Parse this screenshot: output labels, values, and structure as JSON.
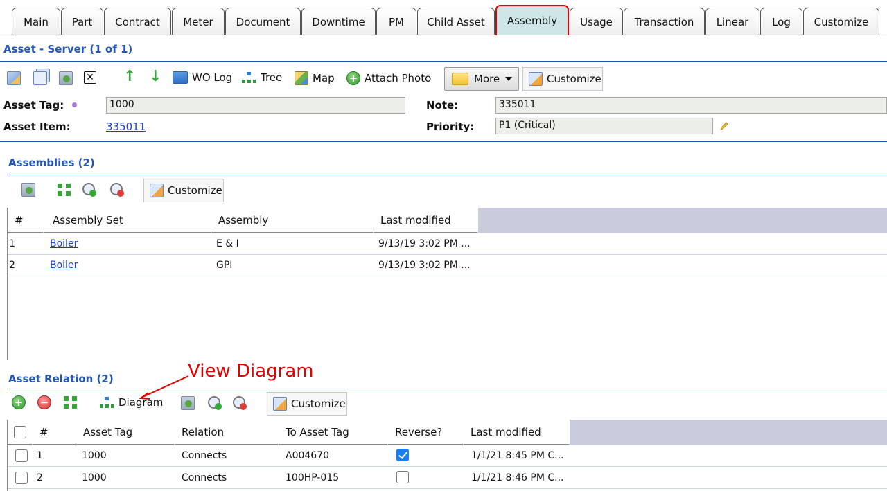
{
  "tabs": [
    {
      "label": "Main"
    },
    {
      "label": "Part"
    },
    {
      "label": "Contract"
    },
    {
      "label": "Meter"
    },
    {
      "label": "Document"
    },
    {
      "label": "Downtime"
    },
    {
      "label": "PM"
    },
    {
      "label": "Child Asset"
    },
    {
      "label": "Assembly",
      "active": true
    },
    {
      "label": "Usage"
    },
    {
      "label": "Transaction"
    },
    {
      "label": "Linear"
    },
    {
      "label": "Log"
    },
    {
      "label": "Customize"
    }
  ],
  "header": {
    "title": "Asset - Server (1 of 1)"
  },
  "toolbar": {
    "wo_log": "WO Log",
    "tree": "Tree",
    "map": "Map",
    "attach_photo": "Attach Photo",
    "more": "More",
    "customize": "Customize"
  },
  "form": {
    "asset_tag_label": "Asset Tag:",
    "asset_tag_value": "1000",
    "asset_item_label": "Asset Item:",
    "asset_item_value": "335011",
    "note_label": "Note:",
    "note_value": "335011",
    "priority_label": "Priority:",
    "priority_value": "P1 (Critical)"
  },
  "assemblies": {
    "title": "Assemblies (2)",
    "customize": "Customize",
    "columns": [
      "#",
      "Assembly Set",
      "Assembly",
      "Last modified"
    ],
    "rows": [
      {
        "num": "1",
        "set": "Boiler",
        "assembly": "E & I",
        "modified": "9/13/19 3:02 PM ..."
      },
      {
        "num": "2",
        "set": "Boiler",
        "assembly": "GPI",
        "modified": "9/13/19 3:02 PM ..."
      }
    ]
  },
  "annotation": {
    "text": "View Diagram"
  },
  "relations": {
    "title": "Asset Relation (2)",
    "diagram": "Diagram",
    "customize": "Customize",
    "columns": [
      "#",
      "Asset Tag",
      "Relation",
      "To Asset Tag",
      "Reverse?",
      "Last modified"
    ],
    "rows": [
      {
        "num": "1",
        "tag": "1000",
        "relation": "Connects",
        "to": "A004670",
        "reverse": true,
        "modified": "1/1/21 8:45 PM C..."
      },
      {
        "num": "2",
        "tag": "1000",
        "relation": "Connects",
        "to": "100HP-015",
        "reverse": false,
        "modified": "1/1/21 8:46 PM C..."
      }
    ]
  },
  "colors": {
    "accent": "#2457b4",
    "annotation": "#e00000",
    "active_tab": "#cfe6e6"
  }
}
